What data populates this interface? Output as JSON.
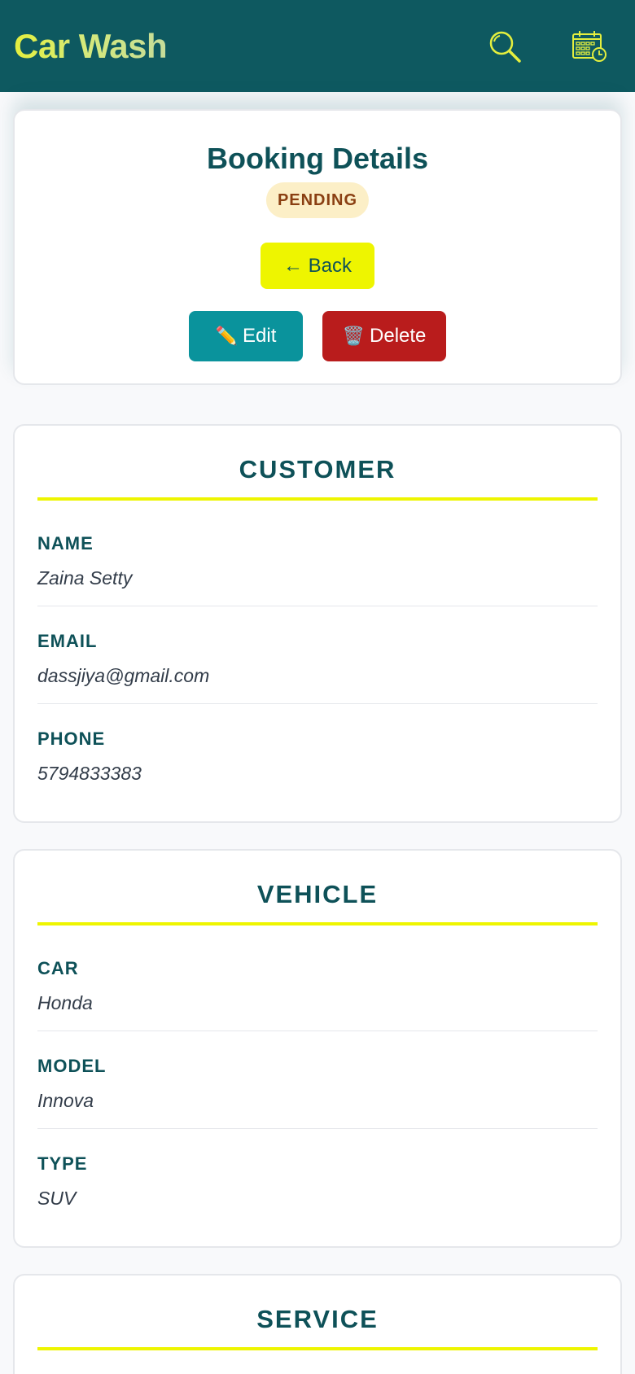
{
  "header": {
    "app_title": "Car Wash",
    "search_icon": "search-icon",
    "calendar_icon": "calendar-clock-icon"
  },
  "booking": {
    "title": "Booking Details",
    "status": "PENDING",
    "back_label": "← Back",
    "edit_icon": "✏️",
    "edit_label": "Edit",
    "delete_icon": "🗑️",
    "delete_label": "Delete"
  },
  "customer": {
    "heading": "CUSTOMER",
    "fields": [
      {
        "label": "NAME",
        "value": "Zaina Setty"
      },
      {
        "label": "EMAIL",
        "value": "dassjiya@gmail.com"
      },
      {
        "label": "PHONE",
        "value": "5794833383"
      }
    ]
  },
  "vehicle": {
    "heading": "VEHICLE",
    "fields": [
      {
        "label": "CAR",
        "value": "Honda"
      },
      {
        "label": "MODEL",
        "value": "Innova"
      },
      {
        "label": "TYPE",
        "value": "SUV"
      }
    ]
  },
  "service": {
    "heading": "SERVICE"
  },
  "colors": {
    "header_bg": "#0e5960",
    "accent_yellow": "#eef500",
    "primary_text": "#0e5158",
    "edit_teal": "#0a939c",
    "delete_red": "#b91c1c",
    "pending_bg": "#fcefc7",
    "pending_text": "#8a3f12"
  }
}
